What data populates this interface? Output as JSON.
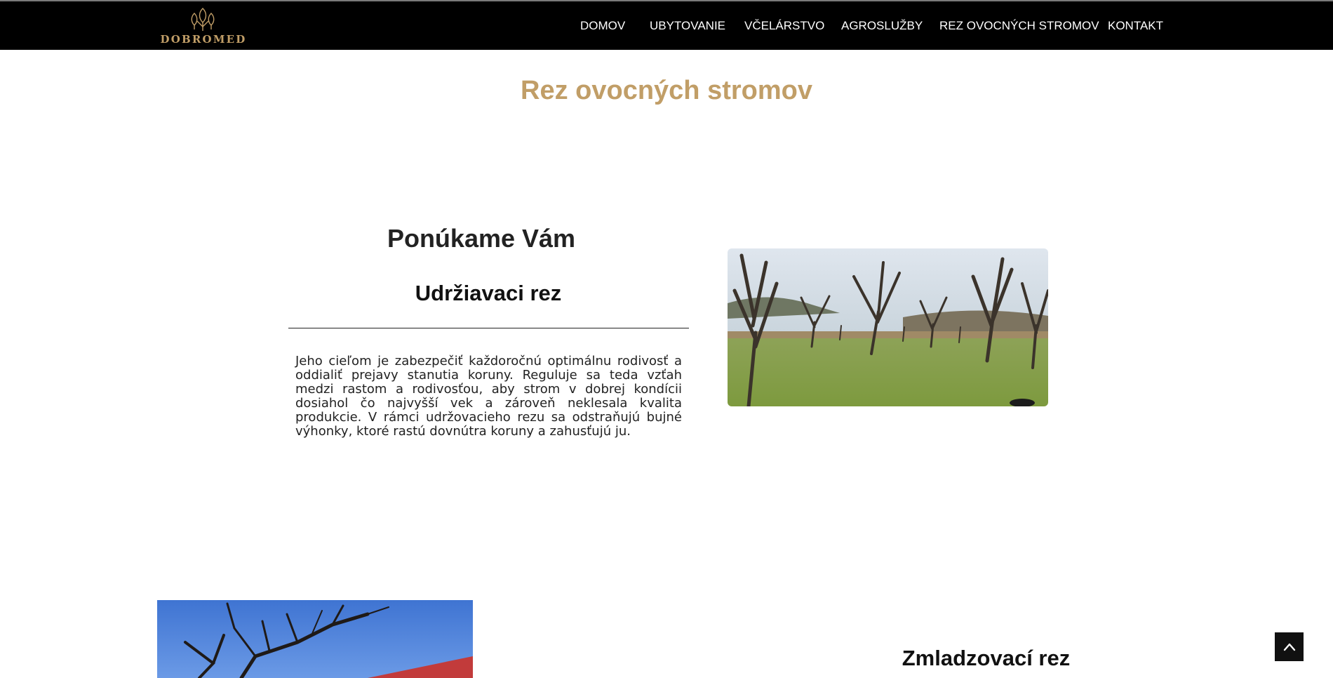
{
  "brand": {
    "name": "DOBROMED",
    "accent_color": "#c19e67",
    "logo_icon": "bee-hive-leaves-icon"
  },
  "nav": {
    "items": [
      {
        "label": "DOMOV"
      },
      {
        "label": "UBYTOVANIE"
      },
      {
        "label": "VČELÁRSTVO"
      },
      {
        "label": "AGROSLUŽBY"
      },
      {
        "label": "REZ OVOCNÝCH STROMOV"
      },
      {
        "label": "KONTAKT"
      }
    ]
  },
  "main": {
    "title": "Rez ovocných stromov",
    "intro_heading": "Ponúkame Vám",
    "sections": [
      {
        "heading": "Udržiavaci rez",
        "text": "Jeho cieľom je zabezpečiť každoročnú optimálnu rodivosť a oddialiť prejavy stanutia koruny. Reguluje sa teda vzťah medzi rastom a rodivosťou, aby strom v dobrej kondícii dosiahol čo najvyšší vek a zároveň neklesala kvalita produkcie. V rámci udržovacieho rezu sa odstraňujú bujné výhonky, ktoré rastú dovnútra koruny a zahusťujú ju.",
        "image": "orchard-photo"
      },
      {
        "heading": "Zmladzovací rez",
        "image": "pruned-tree-photo"
      }
    ]
  },
  "scroll_top": {
    "icon": "chevron-up-icon"
  }
}
